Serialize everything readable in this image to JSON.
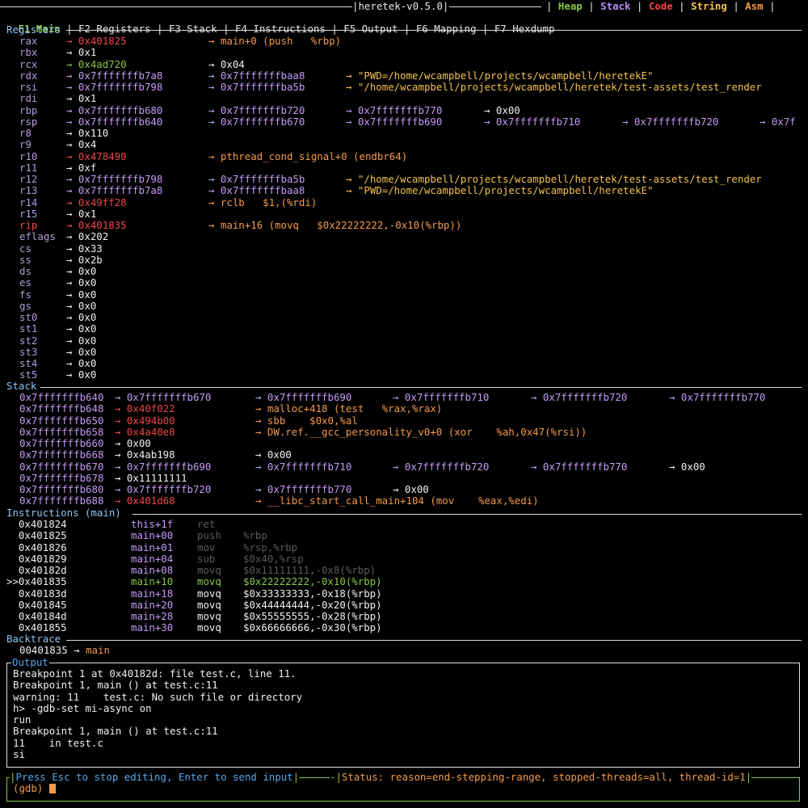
{
  "header": {
    "tabs": [
      {
        "label": "F1 Main"
      },
      {
        "label": "F2 Registers"
      },
      {
        "label": "F3 Stack"
      },
      {
        "label": "F4 Instructions"
      },
      {
        "label": "F5 Output"
      },
      {
        "label": "F6 Mapping"
      },
      {
        "label": "F7 Hexdump"
      }
    ],
    "app_title": "heretek-v0.5.0",
    "legend": {
      "heap": "Heap",
      "stack": "Stack",
      "code": "Code",
      "string": "String",
      "asm": "Asm"
    }
  },
  "colors": {
    "heap": "#86c846",
    "stack": "#b48ef5",
    "code": "#f04545",
    "string": "#f2c14e",
    "asm": "#f39a4a"
  },
  "registers": {
    "title": "Registers",
    "rows": [
      {
        "name": "rax",
        "cells": [
          {
            "t": "→ 0x401825",
            "c": "red"
          },
          {
            "t": "→ main+0 (push   %rbp)",
            "c": "orange"
          }
        ]
      },
      {
        "name": "rbx",
        "cells": [
          {
            "t": "→ 0x1",
            "c": "white"
          }
        ]
      },
      {
        "name": "rcx",
        "cells": [
          {
            "t": "→ 0x4ad720",
            "c": "green"
          },
          {
            "t": "→ 0x04",
            "c": "white"
          }
        ]
      },
      {
        "name": "rdx",
        "cells": [
          {
            "t": "→ 0x7fffffffb7a8",
            "c": "purple"
          },
          {
            "t": "→ 0x7fffffffbaa8",
            "c": "purple"
          },
          {
            "t": "→ \"PWD=/home/wcampbell/projects/wcampbell/heretekE\"",
            "c": "yellow"
          }
        ]
      },
      {
        "name": "rsi",
        "cells": [
          {
            "t": "→ 0x7fffffffb798",
            "c": "purple"
          },
          {
            "t": "→ 0x7fffffffba5b",
            "c": "purple"
          },
          {
            "t": "→ \"/home/wcampbell/projects/wcampbell/heretek/test-assets/test_render",
            "c": "yellow"
          }
        ]
      },
      {
        "name": "rdi",
        "cells": [
          {
            "t": "→ 0x1",
            "c": "white"
          }
        ]
      },
      {
        "name": "rbp",
        "cells": [
          {
            "t": "→ 0x7fffffffb680",
            "c": "purple"
          },
          {
            "t": "→ 0x7fffffffb720",
            "c": "purple"
          },
          {
            "t": "→ 0x7fffffffb770",
            "c": "purple"
          },
          {
            "t": "→ 0x00",
            "c": "white"
          }
        ]
      },
      {
        "name": "rsp",
        "cells": [
          {
            "t": "→ 0x7fffffffb640",
            "c": "purple"
          },
          {
            "t": "→ 0x7fffffffb670",
            "c": "purple"
          },
          {
            "t": "→ 0x7fffffffb690",
            "c": "purple"
          },
          {
            "t": "→ 0x7fffffffb710",
            "c": "purple"
          },
          {
            "t": "→ 0x7fffffffb720",
            "c": "purple"
          },
          {
            "t": "→ 0x7f",
            "c": "purple"
          }
        ]
      },
      {
        "name": "r8",
        "cells": [
          {
            "t": "→ 0x110",
            "c": "white"
          }
        ]
      },
      {
        "name": "r9",
        "cells": [
          {
            "t": "→ 0x4",
            "c": "white"
          }
        ]
      },
      {
        "name": "r10",
        "cells": [
          {
            "t": "→ 0x478490",
            "c": "red"
          },
          {
            "t": "→ pthread_cond_signal+0 (endbr64)",
            "c": "orange"
          }
        ]
      },
      {
        "name": "r11",
        "cells": [
          {
            "t": "→ 0xf",
            "c": "white"
          }
        ]
      },
      {
        "name": "r12",
        "cells": [
          {
            "t": "→ 0x7fffffffb798",
            "c": "purple"
          },
          {
            "t": "→ 0x7fffffffba5b",
            "c": "purple"
          },
          {
            "t": "→ \"/home/wcampbell/projects/wcampbell/heretek/test-assets/test_render",
            "c": "yellow"
          }
        ]
      },
      {
        "name": "r13",
        "cells": [
          {
            "t": "→ 0x7fffffffb7a8",
            "c": "purple"
          },
          {
            "t": "→ 0x7fffffffbaa8",
            "c": "purple"
          },
          {
            "t": "→ \"PWD=/home/wcampbell/projects/wcampbell/heretekE\"",
            "c": "yellow"
          }
        ]
      },
      {
        "name": "r14",
        "cells": [
          {
            "t": "→ 0x49ff28",
            "c": "red"
          },
          {
            "t": "→ rclb   $1,(%rdi)",
            "c": "orange"
          }
        ]
      },
      {
        "name": "r15",
        "cells": [
          {
            "t": "→ 0x1",
            "c": "white"
          }
        ]
      },
      {
        "name": "rip",
        "hl": true,
        "cells": [
          {
            "t": "→ 0x401835",
            "c": "red"
          },
          {
            "t": "→ main+16 (movq   $0x22222222,-0x10(%rbp))",
            "c": "orange"
          }
        ]
      },
      {
        "name": "eflags",
        "cells": [
          {
            "t": "→ 0x202",
            "c": "white"
          }
        ]
      },
      {
        "name": "cs",
        "cells": [
          {
            "t": "→ 0x33",
            "c": "white"
          }
        ]
      },
      {
        "name": "ss",
        "cells": [
          {
            "t": "→ 0x2b",
            "c": "white"
          }
        ]
      },
      {
        "name": "ds",
        "cells": [
          {
            "t": "→ 0x0",
            "c": "white"
          }
        ]
      },
      {
        "name": "es",
        "cells": [
          {
            "t": "→ 0x0",
            "c": "white"
          }
        ]
      },
      {
        "name": "fs",
        "cells": [
          {
            "t": "→ 0x0",
            "c": "white"
          }
        ]
      },
      {
        "name": "gs",
        "cells": [
          {
            "t": "→ 0x0",
            "c": "white"
          }
        ]
      },
      {
        "name": "st0",
        "cells": [
          {
            "t": "→ 0x0",
            "c": "white"
          }
        ]
      },
      {
        "name": "st1",
        "cells": [
          {
            "t": "→ 0x0",
            "c": "white"
          }
        ]
      },
      {
        "name": "st2",
        "cells": [
          {
            "t": "→ 0x0",
            "c": "white"
          }
        ]
      },
      {
        "name": "st3",
        "cells": [
          {
            "t": "→ 0x0",
            "c": "white"
          }
        ]
      },
      {
        "name": "st4",
        "cells": [
          {
            "t": "→ 0x0",
            "c": "white"
          }
        ]
      },
      {
        "name": "st5",
        "cells": [
          {
            "t": "→ 0x0",
            "c": "white"
          }
        ]
      }
    ]
  },
  "stack": {
    "title": "Stack",
    "rows": [
      {
        "addr": "0x7fffffffb640",
        "cells": [
          {
            "t": "→ 0x7fffffffb670",
            "c": "purple"
          },
          {
            "t": "→ 0x7fffffffb690",
            "c": "purple"
          },
          {
            "t": "→ 0x7fffffffb710",
            "c": "purple"
          },
          {
            "t": "→ 0x7fffffffb720",
            "c": "purple"
          },
          {
            "t": "→ 0x7fffffffb770",
            "c": "purple"
          }
        ]
      },
      {
        "addr": "0x7fffffffb648",
        "cells": [
          {
            "t": "→ 0x40f022",
            "c": "red"
          },
          {
            "t": "→ malloc+418 (test   %rax,%rax)",
            "c": "orange"
          }
        ]
      },
      {
        "addr": "0x7fffffffb650",
        "cells": [
          {
            "t": "→ 0x494b00",
            "c": "red"
          },
          {
            "t": "→ sbb    $0x0,%al",
            "c": "orange"
          }
        ]
      },
      {
        "addr": "0x7fffffffb658",
        "cells": [
          {
            "t": "→ 0x4a40e8",
            "c": "red"
          },
          {
            "t": "→ DW.ref.__gcc_personality_v0+0 (xor    %ah,0x47(%rsi))",
            "c": "orange"
          }
        ]
      },
      {
        "addr": "0x7fffffffb660",
        "cells": [
          {
            "t": "→ 0x00",
            "c": "white"
          }
        ]
      },
      {
        "addr": "0x7fffffffb668",
        "cells": [
          {
            "t": "→ 0x4ab198",
            "c": "white"
          },
          {
            "t": "→ 0x00",
            "c": "white"
          }
        ]
      },
      {
        "addr": "0x7fffffffb670",
        "cells": [
          {
            "t": "→ 0x7fffffffb690",
            "c": "purple"
          },
          {
            "t": "→ 0x7fffffffb710",
            "c": "purple"
          },
          {
            "t": "→ 0x7fffffffb720",
            "c": "purple"
          },
          {
            "t": "→ 0x7fffffffb770",
            "c": "purple"
          },
          {
            "t": "→ 0x00",
            "c": "white"
          }
        ]
      },
      {
        "addr": "0x7fffffffb678",
        "cells": [
          {
            "t": "→ 0x11111111",
            "c": "white"
          }
        ]
      },
      {
        "addr": "0x7fffffffb680",
        "cells": [
          {
            "t": "→ 0x7fffffffb720",
            "c": "purple"
          },
          {
            "t": "→ 0x7fffffffb770",
            "c": "purple"
          },
          {
            "t": "→ 0x00",
            "c": "white"
          }
        ]
      },
      {
        "addr": "0x7fffffffb688",
        "cells": [
          {
            "t": "→ 0x401d68",
            "c": "red"
          },
          {
            "t": "→ __libc_start_call_main+104 (mov    %eax,%edi)",
            "c": "orange"
          }
        ]
      }
    ]
  },
  "instructions": {
    "title": "Instructions (main)",
    "rows": [
      {
        "prefix": "  ",
        "addr": "0x401824",
        "sym": "this+1f",
        "op": "ret",
        "args": "",
        "state": "past"
      },
      {
        "prefix": "  ",
        "addr": "0x401825",
        "sym": "main+00",
        "op": "push",
        "args": "%rbp",
        "state": "past"
      },
      {
        "prefix": "  ",
        "addr": "0x401826",
        "sym": "main+01",
        "op": "mov",
        "args": "%rsp,%rbp",
        "state": "past"
      },
      {
        "prefix": "  ",
        "addr": "0x401829",
        "sym": "main+04",
        "op": "sub",
        "args": "$0x40,%rsp",
        "state": "past"
      },
      {
        "prefix": "  ",
        "addr": "0x40182d",
        "sym": "main+08",
        "op": "movq",
        "args": "$0x11111111,-0x8(%rbp)",
        "state": "past"
      },
      {
        "prefix": ">>",
        "addr": "0x401835",
        "sym": "main+10",
        "op": "movq",
        "args": "$0x22222222,-0x10(%rbp)",
        "state": "current"
      },
      {
        "prefix": "  ",
        "addr": "0x40183d",
        "sym": "main+18",
        "op": "movq",
        "args": "$0x33333333,-0x18(%rbp)",
        "state": "future"
      },
      {
        "prefix": "  ",
        "addr": "0x401845",
        "sym": "main+20",
        "op": "movq",
        "args": "$0x44444444,-0x20(%rbp)",
        "state": "future"
      },
      {
        "prefix": "  ",
        "addr": "0x40184d",
        "sym": "main+28",
        "op": "movq",
        "args": "$0x55555555,-0x28(%rbp)",
        "state": "future"
      },
      {
        "prefix": "  ",
        "addr": "0x401855",
        "sym": "main+30",
        "op": "movq",
        "args": "$0x66666666,-0x30(%rbp)",
        "state": "future"
      }
    ]
  },
  "backtrace": {
    "title": "Backtrace",
    "entry_addr": "00401835",
    "entry_arrow": "→",
    "entry_fn": "main"
  },
  "output": {
    "title": "Output",
    "lines": [
      "Breakpoint 1 at 0x40182d: file test.c, line 11.",
      "Breakpoint 1, main () at test.c:11",
      "warning: 11    test.c: No such file or directory",
      "h> -gdb-set mi-async on",
      "run",
      "Breakpoint 1, main () at test.c:11",
      "11    in test.c",
      "si"
    ]
  },
  "input": {
    "hint": "Press Esc to stop editing, Enter to send input",
    "status": "Status: reason=end-stepping-range, stopped-threads=all, thread-id=1",
    "prompt": "(gdb) "
  }
}
